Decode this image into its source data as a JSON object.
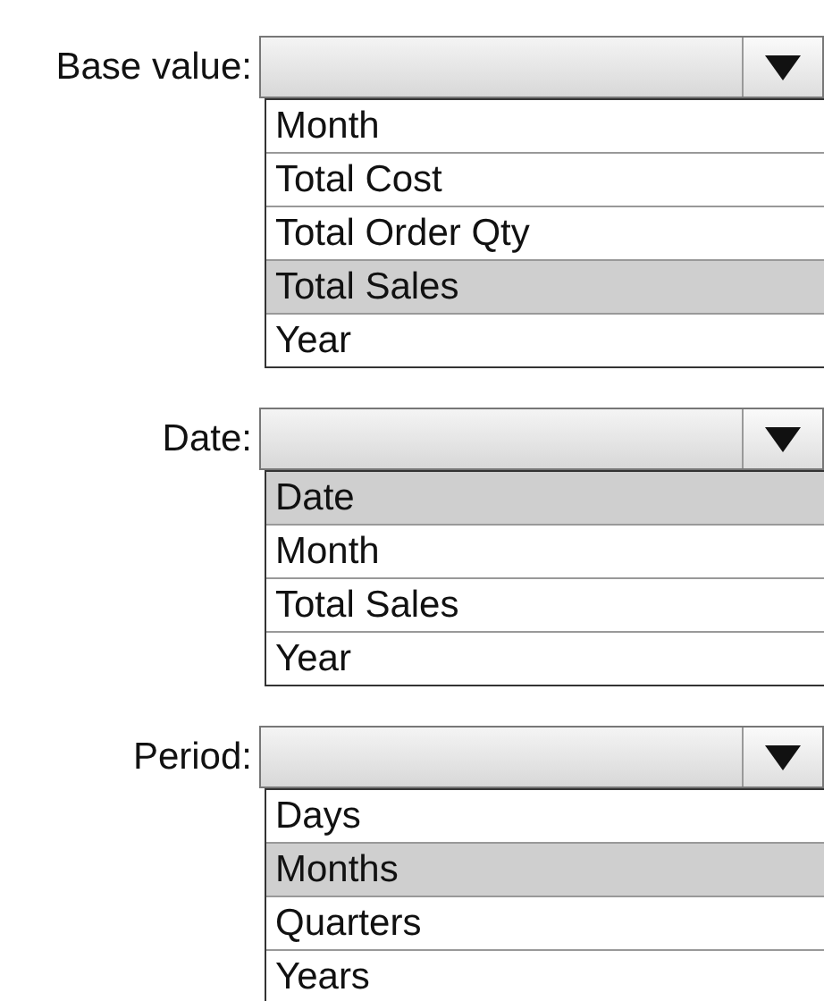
{
  "fields": [
    {
      "label": "Base value:",
      "options": [
        {
          "text": "Month",
          "selected": false
        },
        {
          "text": "Total Cost",
          "selected": false
        },
        {
          "text": "Total Order Qty",
          "selected": false
        },
        {
          "text": "Total Sales",
          "selected": true
        },
        {
          "text": "Year",
          "selected": false
        }
      ]
    },
    {
      "label": "Date:",
      "options": [
        {
          "text": "Date",
          "selected": true
        },
        {
          "text": "Month",
          "selected": false
        },
        {
          "text": "Total Sales",
          "selected": false
        },
        {
          "text": "Year",
          "selected": false
        }
      ]
    },
    {
      "label": "Period:",
      "options": [
        {
          "text": "Days",
          "selected": false
        },
        {
          "text": "Months",
          "selected": true
        },
        {
          "text": "Quarters",
          "selected": false
        },
        {
          "text": "Years",
          "selected": false
        }
      ]
    }
  ]
}
